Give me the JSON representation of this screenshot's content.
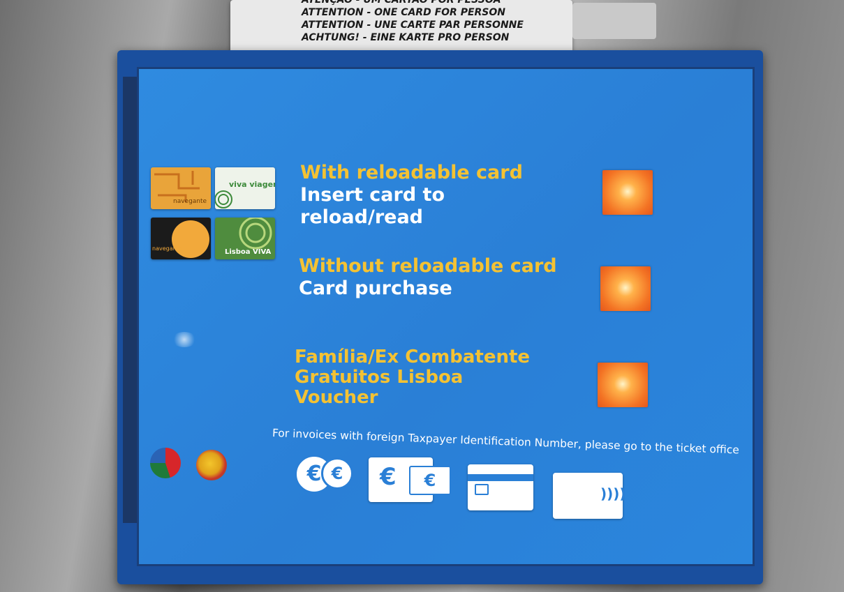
{
  "sticker": {
    "lines": [
      "ATENÇÃO - UM CARTÃO POR PESSOA",
      "ATTENTION - ONE CARD FOR PERSON",
      "ATTENTION - UNE CARTE PAR PERSONNE",
      "ACHTUNG! - EINE KARTE PRO PERSON"
    ]
  },
  "cards": {
    "navegante_1_label": "navegante",
    "viva_viagem_label": "viva viagem",
    "navegante_2_label": "navegante",
    "lisboa_viva_label": "Lisboa VIVA"
  },
  "options": [
    {
      "title": "With reloadable card",
      "subtitle_line1": "Insert card to",
      "subtitle_line2": "reload/read"
    },
    {
      "title": "Without reloadable card",
      "subtitle_line1": "Card purchase"
    },
    {
      "line1": "Família/Ex Combatente",
      "line2": "Gratuitos Lisboa",
      "line3": "Voucher"
    }
  ],
  "invoice_notice": "For invoices with foreign Taxpayer Identification Number, please go to the ticket office",
  "payment": {
    "coin_symbol": "€",
    "note_symbol": "€",
    "nfc_symbol": "))))"
  },
  "colors": {
    "screen_blue": "#2a7fd6",
    "option_title_yellow": "#f4c233",
    "select_button_orange": "#f37324"
  },
  "icons": [
    "portugal-flag-icon",
    "spain-flag-icon",
    "coins-icon",
    "banknote-icon",
    "chip-card-icon",
    "contactless-icon"
  ]
}
